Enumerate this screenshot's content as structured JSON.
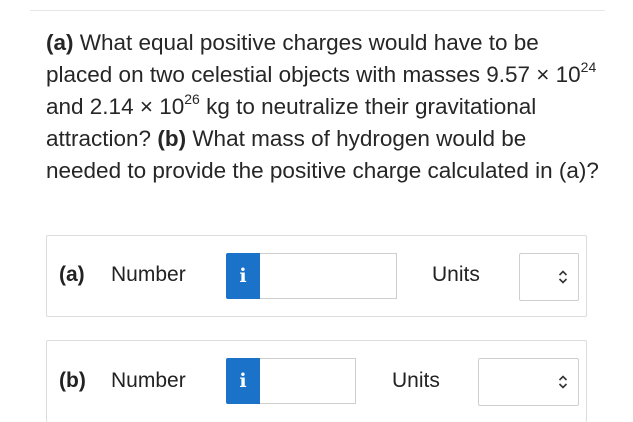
{
  "question": {
    "part_a_tag": "(a)",
    "part_a_text_1": " What equal positive charges would have to be placed on two celestial objects with masses 9.57 × 10",
    "exp1": "24",
    "part_a_text_2": " and 2.14 × 10",
    "exp2": "26",
    "part_a_text_3": " kg to neutralize their gravitational attraction? ",
    "part_b_tag": "(b)",
    "part_b_text": " What mass of hydrogen would be needed to provide the positive charge calculated in (a)?"
  },
  "answers": {
    "a": {
      "part_label": "(a)",
      "number_label": "Number",
      "info_glyph": "i",
      "number_value": "",
      "units_label": "Units",
      "units_value": ""
    },
    "b": {
      "part_label": "(b)",
      "number_label": "Number",
      "info_glyph": "i",
      "number_value": "",
      "units_label": "Units",
      "units_value": ""
    }
  },
  "colors": {
    "info_button": "#1a73c9",
    "border": "#dcdcdc"
  },
  "icons": {
    "info": "info-icon",
    "units_dropdown": "chevron-up-down-icon"
  }
}
